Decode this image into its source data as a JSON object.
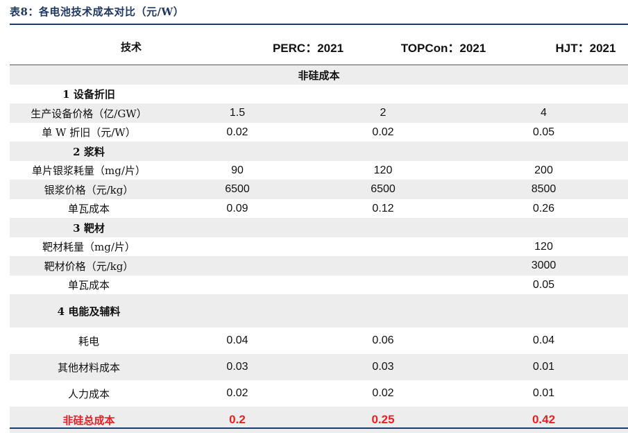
{
  "title": "表8：各电池技术成本对比（元/W）",
  "headers": {
    "tech": "技术",
    "perc": "PERC：2021",
    "topcon": "TOPCon：2021",
    "hjt": "HJT：2021"
  },
  "colors": {
    "title": "#1f3864",
    "total": "#ee1d24",
    "shade": "#ededed"
  },
  "rows": [
    {
      "label": "非硅成本",
      "perc": "",
      "topcon": "",
      "hjt": ""
    },
    {
      "label": "1 设备折旧",
      "perc": "",
      "topcon": "",
      "hjt": ""
    },
    {
      "label": "生产设备价格（亿/GW）",
      "perc": "1.5",
      "topcon": "2",
      "hjt": "4"
    },
    {
      "label": "单 W 折旧（元/W）",
      "perc": "0.02",
      "topcon": "0.02",
      "hjt": "0.05"
    },
    {
      "label": "2 浆料",
      "perc": "",
      "topcon": "",
      "hjt": ""
    },
    {
      "label": "单片银浆耗量（mg/片）",
      "perc": "90",
      "topcon": "120",
      "hjt": "200"
    },
    {
      "label": "银浆价格（元/kg）",
      "perc": "6500",
      "topcon": "6500",
      "hjt": "8500"
    },
    {
      "label": "单瓦成本",
      "perc": "0.09",
      "topcon": "0.12",
      "hjt": "0.26"
    },
    {
      "label": "3 靶材",
      "perc": "",
      "topcon": "",
      "hjt": ""
    },
    {
      "label": "靶材耗量（mg/片）",
      "perc": "",
      "topcon": "",
      "hjt": "120"
    },
    {
      "label": "靶材价格（元/kg）",
      "perc": "",
      "topcon": "",
      "hjt": "3000"
    },
    {
      "label": "单瓦成本",
      "perc": "",
      "topcon": "",
      "hjt": "0.05"
    },
    {
      "label": "4 电能及辅料",
      "perc": "",
      "topcon": "",
      "hjt": ""
    },
    {
      "label": "耗电",
      "perc": "0.04",
      "topcon": "0.06",
      "hjt": "0.04"
    },
    {
      "label": "其他材料成本",
      "perc": "0.03",
      "topcon": "0.03",
      "hjt": "0.01"
    },
    {
      "label": "人力成本",
      "perc": "0.02",
      "topcon": "0.02",
      "hjt": "0.01"
    },
    {
      "label": "非硅总成本",
      "perc": "0.2",
      "topcon": "0.25",
      "hjt": "0.42"
    }
  ]
}
